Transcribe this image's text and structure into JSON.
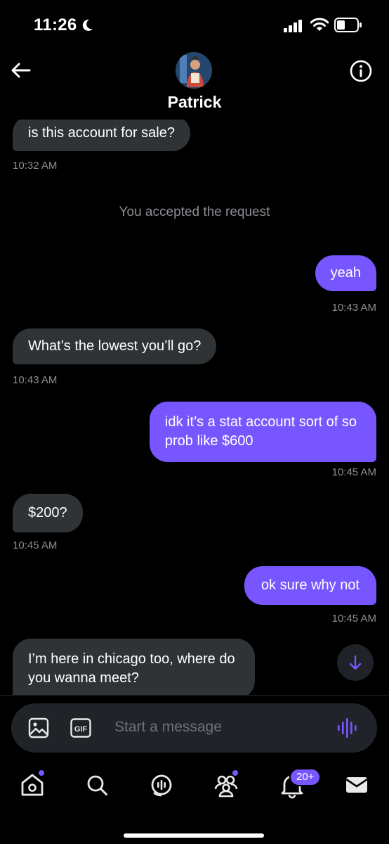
{
  "status_bar": {
    "time": "11:26"
  },
  "header": {
    "contact_name": "Patrick"
  },
  "messages": [
    {
      "direction": "incoming",
      "text": "is this account for sale?",
      "time": "10:32 AM"
    },
    {
      "type": "system",
      "text": "You accepted the request"
    },
    {
      "direction": "outgoing",
      "text": "yeah",
      "time": "10:43 AM"
    },
    {
      "direction": "incoming",
      "text": "What’s the lowest you’ll go?",
      "time": "10:43 AM"
    },
    {
      "direction": "outgoing",
      "lines": [
        "idk it’s a stat account sort of so",
        "prob like $600"
      ],
      "time": "10:45 AM"
    },
    {
      "direction": "incoming",
      "text": "$200?",
      "time": "10:45 AM"
    },
    {
      "direction": "outgoing",
      "text": "ok sure why not",
      "time": "10:45 AM"
    },
    {
      "direction": "incoming",
      "lines": [
        "I’m here in chicago too, where do",
        "you wanna meet?"
      ]
    }
  ],
  "composer": {
    "placeholder": "Start a message",
    "gif_label": "GIF"
  },
  "nav": {
    "items": [
      "home-icon",
      "search-icon",
      "spaces-icon",
      "communities-icon",
      "notifications-icon",
      "messages-icon"
    ],
    "notifications_badge": "20+"
  },
  "colors": {
    "accent": "#7856ff",
    "incoming_bubble": "#2f3336",
    "background": "#000000",
    "muted_text": "#8b8f94"
  }
}
